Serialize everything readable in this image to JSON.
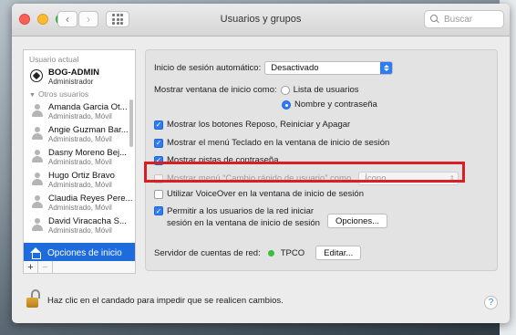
{
  "window": {
    "title": "Usuarios y grupos",
    "search_placeholder": "Buscar"
  },
  "sidebar": {
    "current_user_section": "Usuario actual",
    "current_user": {
      "name": "BOG-ADMIN",
      "role": "Administrador"
    },
    "other_users_section": "Otros usuarios",
    "users": [
      {
        "name": "Amanda Garcia Ot...",
        "role": "Administrado, Móvil"
      },
      {
        "name": "Angie Guzman Bar...",
        "role": "Administrado, Móvil"
      },
      {
        "name": "Dasny Moreno Bej...",
        "role": "Administrado, Móvil"
      },
      {
        "name": "Hugo Ortiz Bravo",
        "role": "Administrado, Móvil"
      },
      {
        "name": "Claudia Reyes Pere...",
        "role": "Administrado, Móvil"
      },
      {
        "name": "David Viracacha S...",
        "role": "Administrado, Móvil"
      }
    ],
    "login_options_label": "Opciones de inicio",
    "add_symbol": "+",
    "remove_symbol": "−"
  },
  "settings": {
    "auto_login_label": "Inicio de sesión automático:",
    "auto_login_value": "Desactivado",
    "show_window_label": "Mostrar ventana de inicio como:",
    "radio_user_list": "Lista de usuarios",
    "radio_name_password": "Nombre y contraseña",
    "cb_sleep_restart": "Mostrar los botones Reposo, Reiniciar y Apagar",
    "cb_input_menu": "Mostrar el menú Teclado en la ventana de inicio de sesión",
    "cb_password_hints": "Mostrar pistas de contraseña",
    "cb_fast_user_switch": "Mostrar menú “Cambio rápido de usuario” como",
    "fast_user_switch_value": "Ícono",
    "cb_voiceover": "Utilizar VoiceOver en la ventana de inicio de sesión",
    "cb_network_users_line1": "Permitir a los usuarios de la red iniciar",
    "cb_network_users_line2": "sesión en la ventana de inicio de sesión",
    "options_button": "Opciones...",
    "network_server_label": "Servidor de cuentas de red:",
    "network_server_value": "TPCO",
    "edit_button": "Editar..."
  },
  "footer": {
    "lock_text": "Haz clic en el candado para impedir que se realicen cambios.",
    "help_symbol": "?"
  },
  "checkmark": "✓"
}
